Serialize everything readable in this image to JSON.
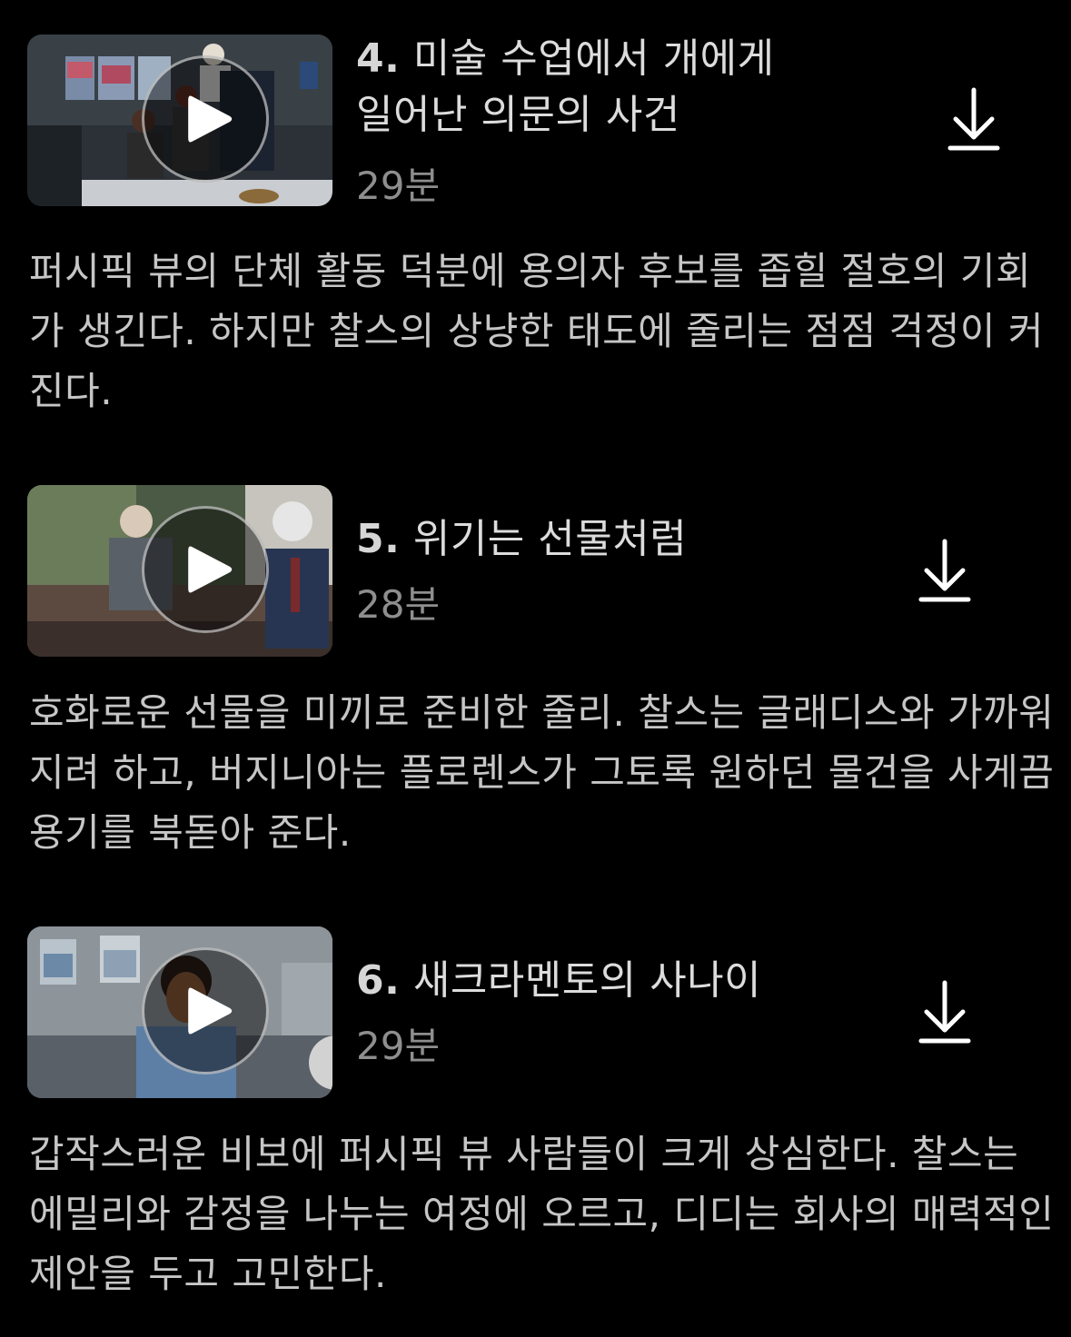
{
  "episodes": [
    {
      "number": "4.",
      "title_line1": "미술 수업에서 개에게",
      "title_line2": "일어난 의문의 사건",
      "duration": "29분",
      "description": "퍼시픽 뷰의 단체 활동 덕분에 용의자 후보를 좁힐 절호의 기회가 생긴다. 하지만 찰스의 상냥한 태도에 줄리는 점점 걱정이 커진다.",
      "play_icon": "play-icon",
      "download_icon": "download-icon"
    },
    {
      "number": "5.",
      "title_line1": "위기는 선물처럼",
      "title_line2": "",
      "duration": "28분",
      "description": "호화로운 선물을 미끼로 준비한 줄리. 찰스는 글래디스와 가까워지려 하고, 버지니아는 플로렌스가 그토록 원하던 물건을 사게끔 용기를 북돋아 준다.",
      "play_icon": "play-icon",
      "download_icon": "download-icon"
    },
    {
      "number": "6.",
      "title_line1": "새크라멘토의 사나이",
      "title_line2": "",
      "duration": "29분",
      "description": "갑작스러운 비보에 퍼시픽 뷰 사람들이 크게 상심한다. 찰스는 에밀리와 감정을 나누는 여정에 오르고, 디디는 회사의 매력적인 제안을 두고 고민한다.",
      "play_icon": "play-icon",
      "download_icon": "download-icon"
    }
  ],
  "colors": {
    "background": "#000000",
    "title": "#dcdcdc",
    "duration": "#8e8e8e",
    "description": "#c6c6c6"
  }
}
